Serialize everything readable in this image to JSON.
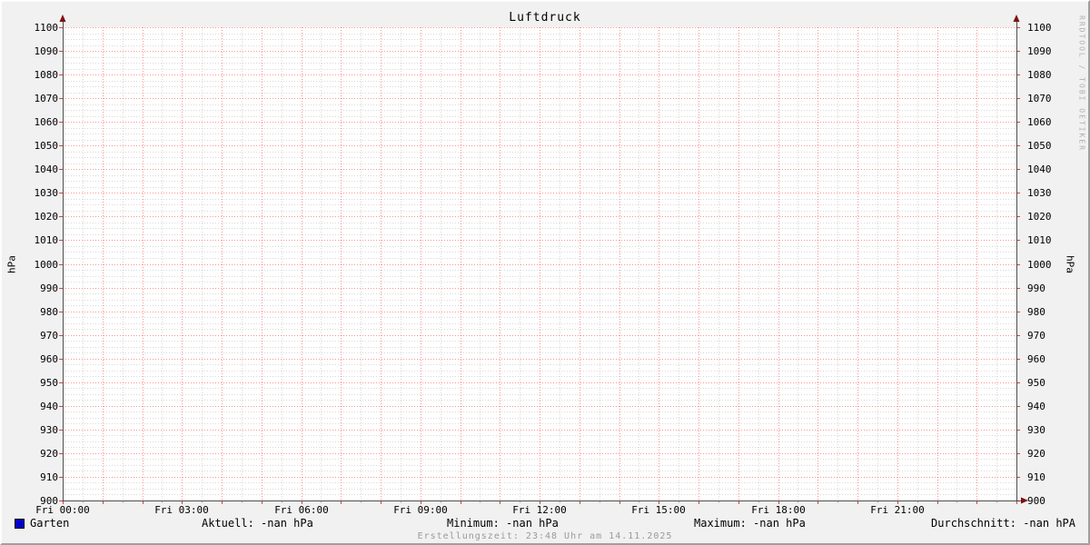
{
  "title": "Luftdruck",
  "watermark": "RRDTOOL / TOBI OETIKER",
  "y_axis": {
    "unit_left": "hPa",
    "unit_right": "hPa"
  },
  "legend": {
    "series_label": "Garten",
    "series_color": "#0000cc",
    "stats": [
      {
        "name": "aktuell",
        "text": "Aktuell: -nan hPa"
      },
      {
        "name": "minimum",
        "text": "Minimum: -nan hPa"
      },
      {
        "name": "maximum",
        "text": "Maximum: -nan hPa"
      },
      {
        "name": "durchschnitt",
        "text": "Durchschnitt: -nan hPA"
      }
    ]
  },
  "footer": {
    "creation_text": "Erstellungszeit: 23:48 Uhr am 14.11.2025"
  },
  "chart_data": {
    "type": "line",
    "title": "Luftdruck",
    "ylabel": "hPa",
    "ylabel_right": "hPa",
    "ylim": [
      900,
      1100
    ],
    "y_major_step": 10,
    "y_minor_step": 2.5,
    "x_range_hours": 24,
    "x_major_step_hours": 1,
    "x_minor_step_hours": 0.5,
    "x_label_step_hours": 3,
    "x_tick_labels": [
      "Fri 00:00",
      "Fri 03:00",
      "Fri 06:00",
      "Fri 09:00",
      "Fri 12:00",
      "Fri 15:00",
      "Fri 18:00",
      "Fri 21:00"
    ],
    "grid": {
      "major": true,
      "minor": true,
      "style": "dotted"
    },
    "legend_position": "bottom",
    "series": [
      {
        "name": "Garten",
        "color": "#0000cc",
        "values": [],
        "note": "no data plotted, all values -nan"
      }
    ],
    "stats": {
      "aktuell": "-nan hPa",
      "minimum": "-nan hPa",
      "maximum": "-nan hPa",
      "durchschnitt": "-nan hPA"
    }
  },
  "colors": {
    "background": "#f1f1f1",
    "canvas": "#ffffff",
    "major_grid": "#ff0000",
    "minor_grid": "#9a9a9a",
    "axis": "#3c3c3c",
    "arrow": "#7f1010",
    "major_tick": "#cc3333",
    "text": "#000000",
    "muted": "#9a9a9a",
    "watermark": "#b0b0b0"
  }
}
